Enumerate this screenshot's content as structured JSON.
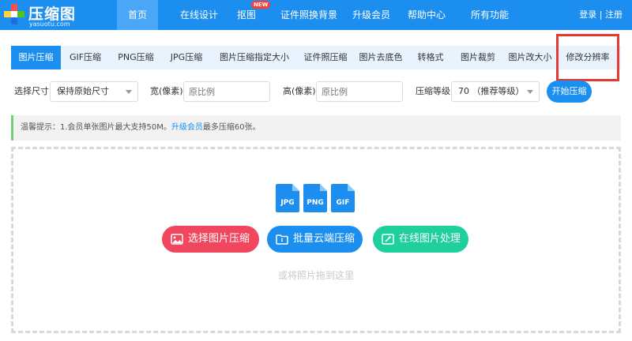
{
  "logo": {
    "name": "压缩图",
    "domain": "yasuotu.com"
  },
  "nav": {
    "items": [
      {
        "label": "首页",
        "active": true
      },
      {
        "label": "在线设计"
      },
      {
        "label": "抠图",
        "badge": "NEW"
      },
      {
        "label": "证件照换背景"
      },
      {
        "label": "升级会员"
      },
      {
        "label": "帮助中心"
      },
      {
        "label": "所有功能"
      }
    ],
    "login": "登录 | 注册"
  },
  "tabs": [
    {
      "label": "图片压缩",
      "active": true
    },
    {
      "label": "GIF压缩"
    },
    {
      "label": "PNG压缩"
    },
    {
      "label": "JPG压缩"
    },
    {
      "label": "图片压缩指定大小"
    },
    {
      "label": "证件照压缩"
    },
    {
      "label": "图片去底色"
    },
    {
      "label": "转格式"
    },
    {
      "label": "图片裁剪"
    },
    {
      "label": "图片改大小"
    },
    {
      "label": "修改分辨率",
      "highlighted": true
    }
  ],
  "options": {
    "size_label": "选择尺寸",
    "size_value": "保持原始尺寸",
    "width_label": "宽(像素)",
    "width_placeholder": "原比例",
    "height_label": "高(像素)",
    "height_placeholder": "原比例",
    "level_label": "压缩等级",
    "level_value": "70 （推荐等级）",
    "start_button": "开始压缩"
  },
  "tip": {
    "prefix": "温馨提示：1.会员单张图片最大支持50M。",
    "link": "升级会员",
    "suffix": "最多压缩60张。"
  },
  "upload": {
    "file_types": [
      "JPG",
      "PNG",
      "GIF"
    ],
    "buttons": {
      "select": "选择图片压缩",
      "cloud": "批量云端压缩",
      "online": "在线图片处理"
    },
    "drop_hint": "或将照片拖到这里"
  },
  "colors": {
    "primary": "#1b8ef0",
    "nav_active": "#4aa6f7",
    "tab_bg": "#e8f3fd",
    "highlight_box": "#e53935",
    "btn_select": "#f0475f",
    "btn_cloud": "#1b8ef0",
    "btn_online": "#1fcf9c",
    "tip_border": "#6fcf73"
  }
}
